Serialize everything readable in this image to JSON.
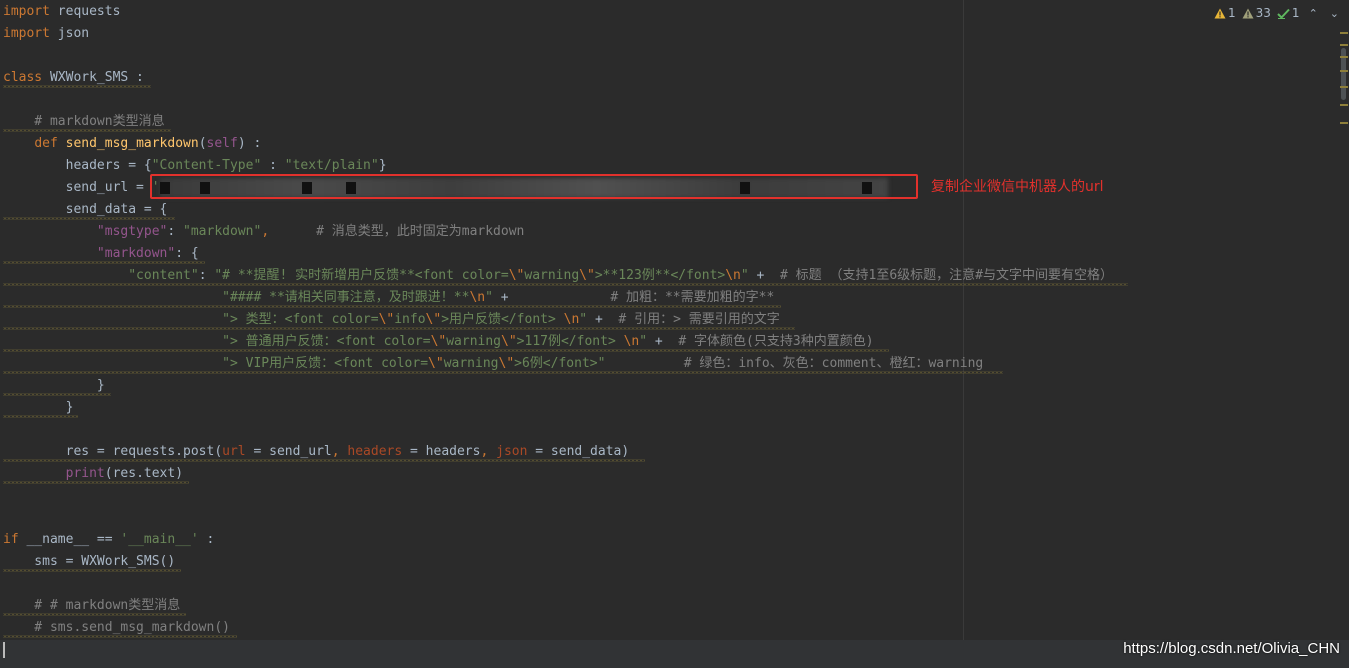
{
  "inspection": {
    "warnings": "1",
    "weak_warnings": "33",
    "typos": "1",
    "colors": {
      "warning": "#e7b537",
      "weak": "#a0a07a",
      "ok": "#5fb85f"
    }
  },
  "annotation": {
    "text": "复制企业微信中机器人的url",
    "color": "#e2312c"
  },
  "watermark": "https://blog.csdn.net/Olivia_CHN",
  "code": {
    "l1_kw": "import",
    "l1_rest": " requests",
    "l2_kw": "import",
    "l2_rest": " json",
    "l4_kw": "class",
    "l4_rest": " WXWork_SMS :",
    "l6_comment": "    # markdown类型消息",
    "l7_indent": "    ",
    "l7_kw": "def",
    "l7_fn": " send_msg_markdown",
    "l7_open": "(",
    "l7_self": "self",
    "l7_close": ") :",
    "l8_pre": "        headers = {",
    "l8_s1": "\"Content-Type\"",
    "l8_mid": " : ",
    "l8_s2": "\"text/plain\"",
    "l8_end": "}",
    "l9_pre": "        send_url = ",
    "l9_s": "'",
    "l10": "        send_data = {",
    "l11_indent": "            ",
    "l11_key": "\"msgtype\"",
    "l11_colon": ": ",
    "l11_val": "\"markdown\"",
    "l11_comma": ",",
    "l11_comment": "      # 消息类型，此时固定为markdown",
    "l12_indent": "            ",
    "l12_key": "\"markdown\"",
    "l12_rest": ": {",
    "l13_indent": "                ",
    "l13_key": "\"content\"",
    "l13_colon": ": ",
    "l13_s1": "\"# **提醒! 实时新增用户反馈**<font color=",
    "l13_e1": "\\\"",
    "l13_s2": "warning",
    "l13_e2": "\\\"",
    "l13_s3": ">**123例**</font>",
    "l13_e3": "\\n",
    "l13_s4": "\"",
    "l13_plus": " + ",
    "l13_comment": " # 标题 （支持1至6级标题，注意#与文字中间要有空格）",
    "l14_indent": "                            ",
    "l14_s1": "\"#### **请相关同事注意，及时跟进！**",
    "l14_e1": "\\n",
    "l14_s2": "\"",
    "l14_plus": " +",
    "l14_comment": "             # 加粗：**需要加粗的字**",
    "l15_indent": "                            ",
    "l15_s1": "\"> 类型：<font color=",
    "l15_e1": "\\\"",
    "l15_s2": "info",
    "l15_e2": "\\\"",
    "l15_s3": ">用户反馈</font> ",
    "l15_e3": "\\n",
    "l15_s4": "\"",
    "l15_plus": " + ",
    "l15_comment": " # 引用：> 需要引用的文字",
    "l16_indent": "                            ",
    "l16_s1": "\"> 普通用户反馈：<font color=",
    "l16_e1": "\\\"",
    "l16_s2": "warning",
    "l16_e2": "\\\"",
    "l16_s3": ">117例</font> ",
    "l16_e3": "\\n",
    "l16_s4": "\"",
    "l16_plus": " + ",
    "l16_comment": " # 字体颜色(只支持3种内置颜色)",
    "l17_indent": "                            ",
    "l17_s1": "\"> VIP用户反馈：<font color=",
    "l17_e1": "\\\"",
    "l17_s2": "warning",
    "l17_e2": "\\\"",
    "l17_s3": ">6例</font>\"",
    "l17_comment": "          # 绿色：info、灰色：comment、橙红：warning",
    "l18": "            }",
    "l19": "        }",
    "l21_pre": "        res = requests.post(",
    "l21_p1": "url",
    "l21_m1": " = send_url",
    "l21_c1": ", ",
    "l21_p2": "headers",
    "l21_m2": " = headers",
    "l21_c2": ", ",
    "l21_p3": "json",
    "l21_m3": " = send_data)",
    "l22_indent": "        ",
    "l22_fn": "print",
    "l22_rest": "(res.text)",
    "l25_kw": "if",
    "l25_mid": " __name__ == ",
    "l25_str": "'__main__'",
    "l25_end": " :",
    "l26_pre": "    sms = WXWork_SMS()",
    "l28_comment": "    # # markdown类型消息",
    "l29_comment": "    # sms.send_msg_markdown()"
  }
}
